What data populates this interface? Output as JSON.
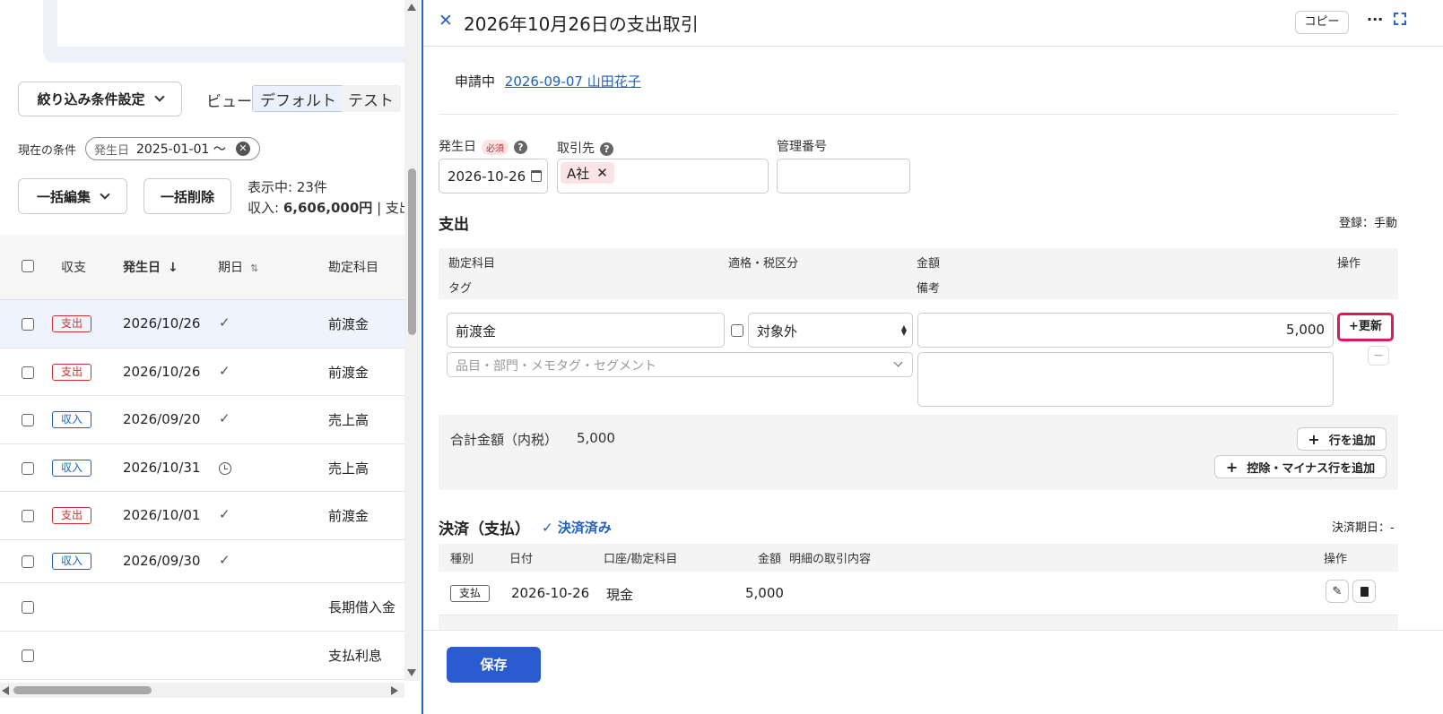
{
  "left": {
    "filter_button": "絞り込み条件設定",
    "view_label": "ビュー",
    "views": [
      "デフォルト",
      "テスト"
    ],
    "current_conditions_label": "現在の条件",
    "condition_chip": {
      "key": "発生日",
      "value": "2025-01-01 〜"
    },
    "bulk_edit": "一括編集",
    "bulk_delete": "一括削除",
    "showing": "表示中: 23件",
    "summary_prefix": "収入: ",
    "summary_amount": "6,606,000円",
    "summary_suffix": " | 支出:",
    "columns": {
      "type": "収支",
      "date": "発生日",
      "due": "期日",
      "account": "勘定科目"
    },
    "rows": [
      {
        "badge": "支出",
        "kind": "out",
        "date": "2026/10/26",
        "due": "check",
        "account": "前渡金",
        "selected": true
      },
      {
        "badge": "支出",
        "kind": "out",
        "date": "2026/10/26",
        "due": "check",
        "account": "前渡金"
      },
      {
        "badge": "収入",
        "kind": "in",
        "date": "2026/09/20",
        "due": "check",
        "account": "売上高"
      },
      {
        "badge": "収入",
        "kind": "in",
        "date": "2026/10/31",
        "due": "clock",
        "account": "売上高"
      },
      {
        "badge": "支出",
        "kind": "out",
        "date": "2026/10/01",
        "due": "check",
        "account": "前渡金"
      },
      {
        "badge": "収入",
        "kind": "in",
        "date": "2026/09/30",
        "due": "check",
        "account": ""
      },
      {
        "badge": "",
        "kind": "",
        "date": "",
        "due": "",
        "account": "長期借入金"
      },
      {
        "badge": "",
        "kind": "",
        "date": "",
        "due": "",
        "account": "支払利息"
      }
    ]
  },
  "panel": {
    "title": "2026年10月26日の支出取引",
    "copy": "コピー",
    "status": "申請中",
    "status_link": "2026-09-07 山田花子",
    "issue_date_label": "発生日",
    "required": "必須",
    "issue_date_value": "2026-10-26",
    "partner_label": "取引先",
    "partner_tag": "A社",
    "mgmt_label": "管理番号",
    "section_title": "支出",
    "registration": "登録：手動",
    "cols": {
      "account": "勘定科目",
      "tax": "適格・税区分",
      "amount": "金額",
      "op": "操作",
      "tag": "タグ",
      "memo": "備考"
    },
    "line": {
      "account": "前渡金",
      "tax": "対象外",
      "amount": "5,000",
      "update": "+更新",
      "tags_placeholder": "品目・部門・メモタグ・セグメント"
    },
    "total_label": "合計金額（内税）",
    "total_value": "5,000",
    "add_row": "行を追加",
    "add_deduction": "控除・マイナス行を追加",
    "payment_title": "決済（支払）",
    "payment_status": "決済済み",
    "due_label": "決済期日：-",
    "pay_cols": {
      "kind": "種別",
      "date": "日付",
      "account": "口座/勘定科目",
      "amount": "金額",
      "desc": "明細の取引内容",
      "op": "操作"
    },
    "pay_row": {
      "kind": "支払",
      "date": "2026-10-26",
      "account": "現金",
      "amount": "5,000"
    },
    "save": "保存"
  },
  "colors": {
    "accent": "#2a5bd0",
    "out": "#d32f2f",
    "in": "#1f5fbf",
    "highlight": "#e0185a"
  }
}
